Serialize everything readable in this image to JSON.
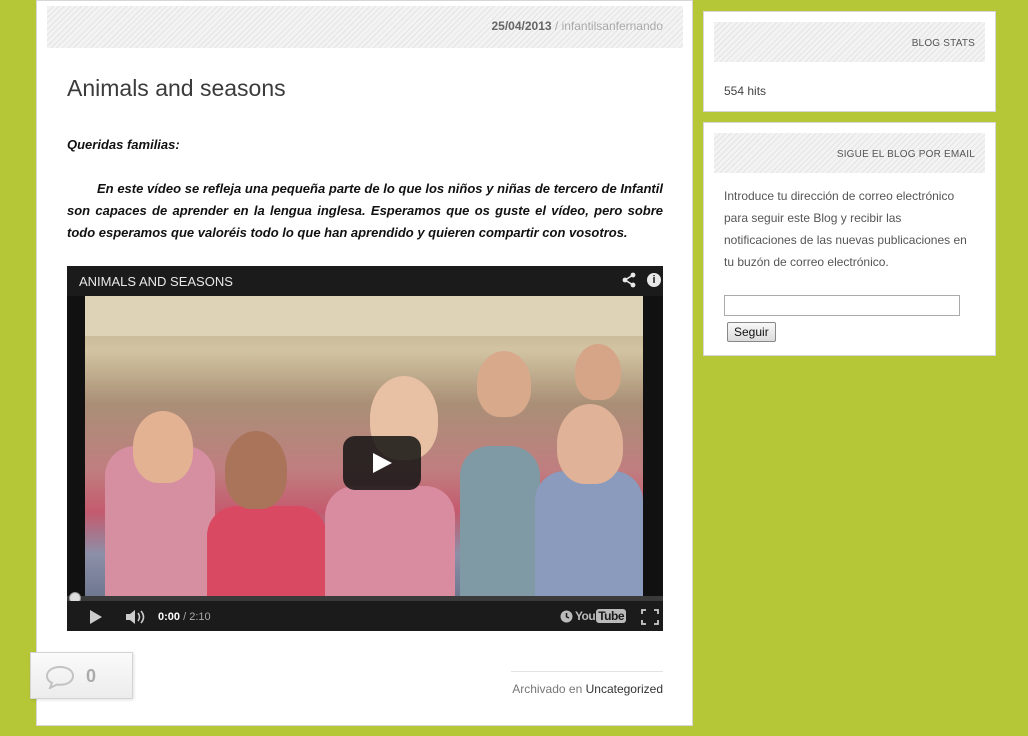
{
  "post": {
    "date": "25/04/2013",
    "separator": " / ",
    "author": "infantilsanfernando",
    "title": "Animals and seasons",
    "greeting": "Queridas familias:",
    "paragraph": "En este vídeo se refleja una pequeña parte de lo que los niños y niñas de tercero de Infantil son capaces de aprender en la lengua inglesa. Esperamos que os guste el vídeo, pero sobre todo esperamos que valoréis todo lo que han aprendido y quieren compartir con vosotros.",
    "filed_prefix": "Archivado en ",
    "filed_category": "Uncategorized",
    "comment_count": "0"
  },
  "video": {
    "title": "ANIMALS AND SEASONS",
    "time_current": "0:00",
    "time_separator": " / ",
    "time_duration": "2:10",
    "progress_fraction": 0,
    "logo_you": "You",
    "logo_tube": "Tube",
    "info_glyph": "i",
    "icons": [
      "share-icon",
      "info-icon",
      "play-icon",
      "volume-icon",
      "clock-icon",
      "fullscreen-icon"
    ]
  },
  "sidebar": {
    "stats": {
      "heading": "BLOG STATS",
      "hits": "554 hits"
    },
    "email": {
      "heading": "SIGUE EL BLOG POR EMAIL",
      "description": "Introduce tu dirección de correo electrónico para seguir este Blog y recibir las notificaciones de las nuevas publicaciones en tu buzón de correo electrónico.",
      "input_value": "",
      "button_label": "Seguir"
    }
  },
  "colors": {
    "background": "#b5c637",
    "panel": "#ffffff",
    "video_bar": "#1b1b1b"
  }
}
